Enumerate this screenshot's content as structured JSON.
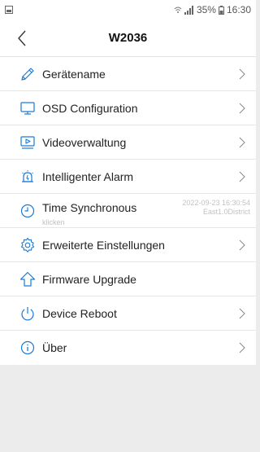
{
  "status_bar": {
    "battery_percent": "35%",
    "time": "16:30"
  },
  "header": {
    "title": "W2036"
  },
  "menu": {
    "items": [
      {
        "label": "Gerätename",
        "icon": "pencil-icon"
      },
      {
        "label": "OSD Configuration",
        "icon": "monitor-icon"
      },
      {
        "label": "Videoverwaltung",
        "icon": "video-play-icon"
      },
      {
        "label": "Intelligenter Alarm",
        "icon": "alarm-icon"
      },
      {
        "label": "Time Synchronous",
        "icon": "clock-icon",
        "sub_label": "klicken",
        "datetime": "2022-09-23 16:30:54",
        "timezone": "East1.0District"
      },
      {
        "label": "Erweiterte Einstellungen",
        "icon": "gear-icon"
      },
      {
        "label": "Firmware Upgrade",
        "icon": "upload-arrow-icon"
      },
      {
        "label": "Device Reboot",
        "icon": "power-icon"
      },
      {
        "label": "Über",
        "icon": "info-icon"
      }
    ]
  },
  "colors": {
    "accent": "#1a7ad6",
    "text": "#222222",
    "divider": "#e6e6e6",
    "background": "#ececec"
  }
}
